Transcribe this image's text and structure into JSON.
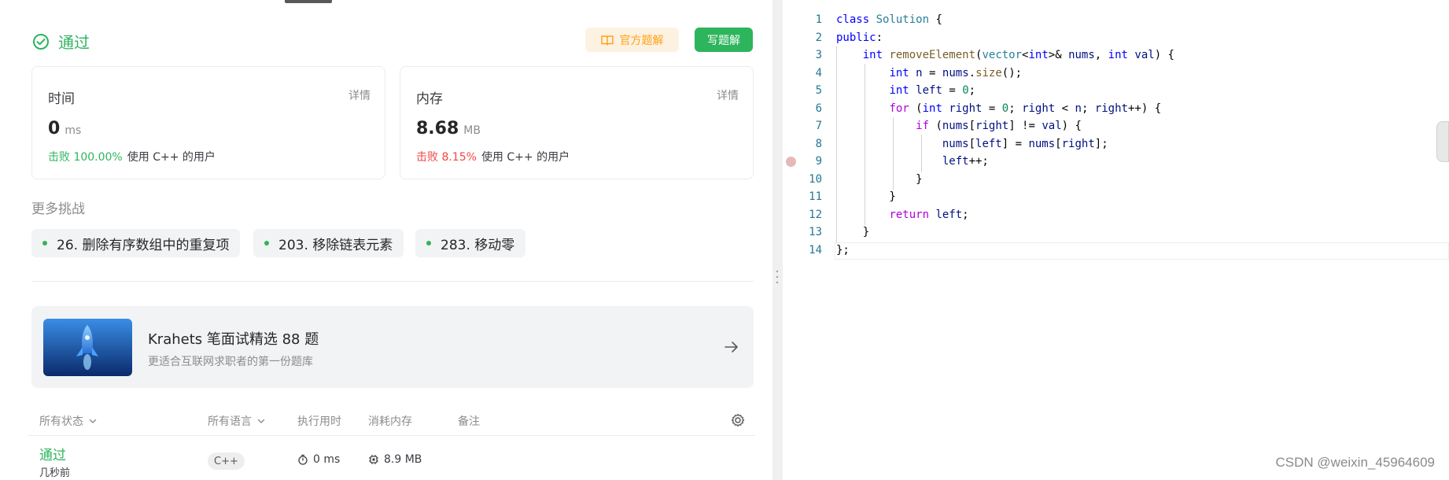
{
  "result": {
    "status": "通过",
    "official_solution_button": "官方题解",
    "write_solution_button": "写题解"
  },
  "stats": {
    "time": {
      "title": "时间",
      "detail": "详情",
      "value": "0",
      "unit": "ms",
      "beat": "击败 100.00%",
      "beat_rest": "使用 C++ 的用户"
    },
    "memory": {
      "title": "内存",
      "detail": "详情",
      "value": "8.68",
      "unit": "MB",
      "beat": "击败 8.15%",
      "beat_rest": "使用 C++ 的用户"
    }
  },
  "more": {
    "title": "更多挑战",
    "items": [
      {
        "label": "26. 删除有序数组中的重复项"
      },
      {
        "label": "203. 移除链表元素"
      },
      {
        "label": "283. 移动零"
      }
    ]
  },
  "banner": {
    "title": "Krahets 笔面试精选 88 题",
    "subtitle": "更适合互联网求职者的第一份题库"
  },
  "submissions": {
    "headers": {
      "status": "所有状态",
      "language": "所有语言",
      "runtime": "执行用时",
      "memory": "消耗内存",
      "notes": "备注"
    },
    "rows": [
      {
        "status": "通过",
        "time_ago": "几秒前",
        "language": "C++",
        "runtime": "0 ms",
        "memory": "8.9 MB"
      }
    ]
  },
  "editor": {
    "line_numbers": [
      "1",
      "2",
      "3",
      "4",
      "5",
      "6",
      "7",
      "8",
      "9",
      "10",
      "11",
      "12",
      "13",
      "14"
    ]
  },
  "watermark": "CSDN @weixin_45964609",
  "colors": {
    "accent_green": "#2db55d",
    "accent_orange": "#ffa116",
    "beat_red": "#ef4743"
  }
}
